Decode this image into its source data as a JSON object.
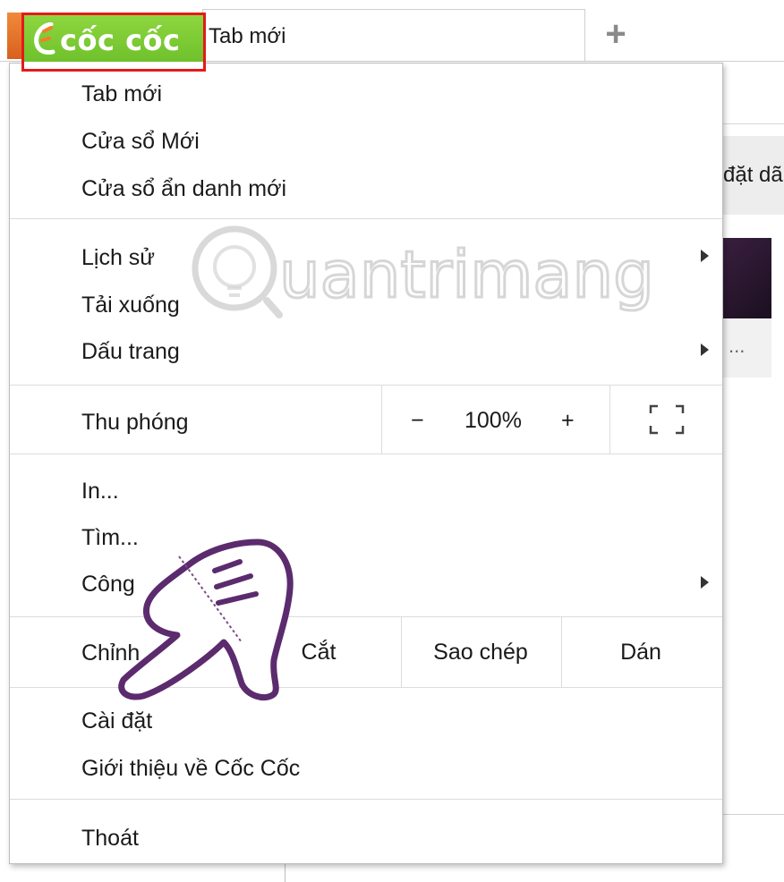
{
  "tabstrip": {
    "logo_text": "cốc cốc",
    "tab_title": "Tab mới",
    "new_tab_label": "+"
  },
  "background": {
    "partial_text": "đặt dã",
    "ellipsis": "..."
  },
  "menu": {
    "new_tab": "Tab mới",
    "new_window": "Cửa sổ Mới",
    "incognito": "Cửa sổ ẩn danh mới",
    "history": "Lịch sử",
    "downloads": "Tải xuống",
    "bookmarks": "Dấu trang",
    "zoom_label": "Thu phóng",
    "zoom_minus": "−",
    "zoom_level": "100%",
    "zoom_plus": "+",
    "print": "In...",
    "find": "Tìm...",
    "tools": "Công",
    "edit_label": "Chỉnh",
    "cut": "Cắt",
    "copy": "Sao chép",
    "paste": "Dán",
    "settings": "Cài đặt",
    "about": "Giới thiệu về Cốc Cốc",
    "exit": "Thoát"
  },
  "watermark": {
    "text": "uantrimang"
  },
  "colors": {
    "highlight_border": "#e51919",
    "logo_green": "#7cc835",
    "hand_outline": "#5b2b6e"
  },
  "icons": {
    "fullscreen": "fullscreen-icon",
    "submenu": "chevron-right-icon",
    "logo": "coccoc-logo-icon",
    "pointer": "pointing-hand-icon"
  }
}
